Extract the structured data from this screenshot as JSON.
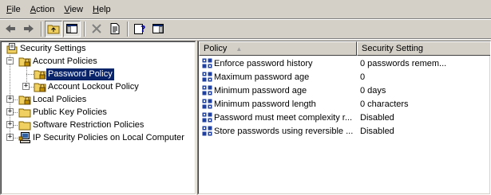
{
  "menu": {
    "file": {
      "accel": "F",
      "rest": "ile"
    },
    "action": {
      "accel": "A",
      "rest": "ction"
    },
    "view": {
      "accel": "V",
      "rest": "iew"
    },
    "help": {
      "accel": "H",
      "rest": "elp"
    }
  },
  "toolbar": {
    "buttons": [
      "back-icon",
      "forward-icon",
      "up-one-level-icon",
      "show-hide-console-tree-icon",
      "delete-icon",
      "export-list-icon",
      "help-icon",
      "show-hide-action-pane-icon"
    ]
  },
  "tree": {
    "root": "Security Settings",
    "items": [
      {
        "label": "Account Policies",
        "expander": "−"
      },
      {
        "label": "Password Policy",
        "selected": true
      },
      {
        "label": "Account Lockout Policy",
        "expander": "+"
      },
      {
        "label": "Local Policies",
        "expander": "+"
      },
      {
        "label": "Public Key Policies",
        "expander": "+"
      },
      {
        "label": "Software Restriction Policies",
        "expander": "+"
      },
      {
        "label": "IP Security Policies on Local Computer",
        "expander": "+"
      }
    ]
  },
  "list": {
    "columns": {
      "policy": "Policy",
      "sort_glyph": "▲",
      "setting": "Security Setting"
    },
    "rows": [
      {
        "policy": "Enforce password history",
        "setting": "0 passwords remem..."
      },
      {
        "policy": "Maximum password age",
        "setting": "0"
      },
      {
        "policy": "Minimum password age",
        "setting": "0 days"
      },
      {
        "policy": "Minimum password length",
        "setting": "0 characters"
      },
      {
        "policy": "Password must meet complexity r...",
        "setting": "Disabled"
      },
      {
        "policy": "Store passwords using reversible ...",
        "setting": "Disabled"
      }
    ]
  },
  "colors": {
    "window": "#d4d0c8",
    "selection": "#0a246a",
    "folder": "#f0d060"
  }
}
